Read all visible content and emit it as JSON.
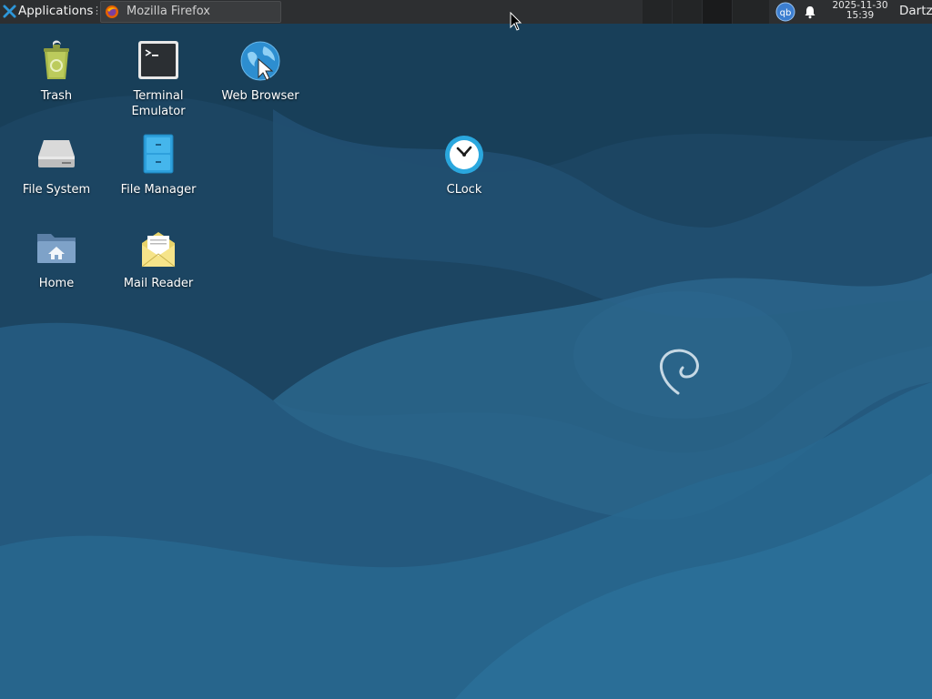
{
  "panel": {
    "applications_label": "Applications",
    "applications_separator": "⋮",
    "task": {
      "label": "Mozilla Firefox",
      "icon": "firefox-icon"
    },
    "tray": {
      "qbittorrent_icon": "qbittorrent-icon",
      "qbittorrent_text": "qb",
      "notification_icon": "bell-icon",
      "date": "2025-11-30",
      "time": "15:39",
      "user": "Dartz"
    }
  },
  "desktop": {
    "icons": [
      {
        "label": "Trash",
        "icon": "trash-icon"
      },
      {
        "label": "Terminal\nEmulator",
        "icon": "terminal-icon"
      },
      {
        "label": "Web Browser",
        "icon": "web-browser-icon"
      },
      {
        "label": "File System",
        "icon": "drive-icon"
      },
      {
        "label": "File Manager",
        "icon": "file-cabinet-icon"
      },
      {
        "label": "CLock",
        "icon": "clock-icon"
      },
      {
        "label": "Home",
        "icon": "home-folder-icon"
      },
      {
        "label": "Mail Reader",
        "icon": "mail-icon"
      }
    ]
  },
  "colors": {
    "panel_bg": "#2d2f31",
    "wallpaper_dark": "#1f4a68",
    "wallpaper_light": "#2a6d99",
    "accent": "#2d96d8"
  }
}
